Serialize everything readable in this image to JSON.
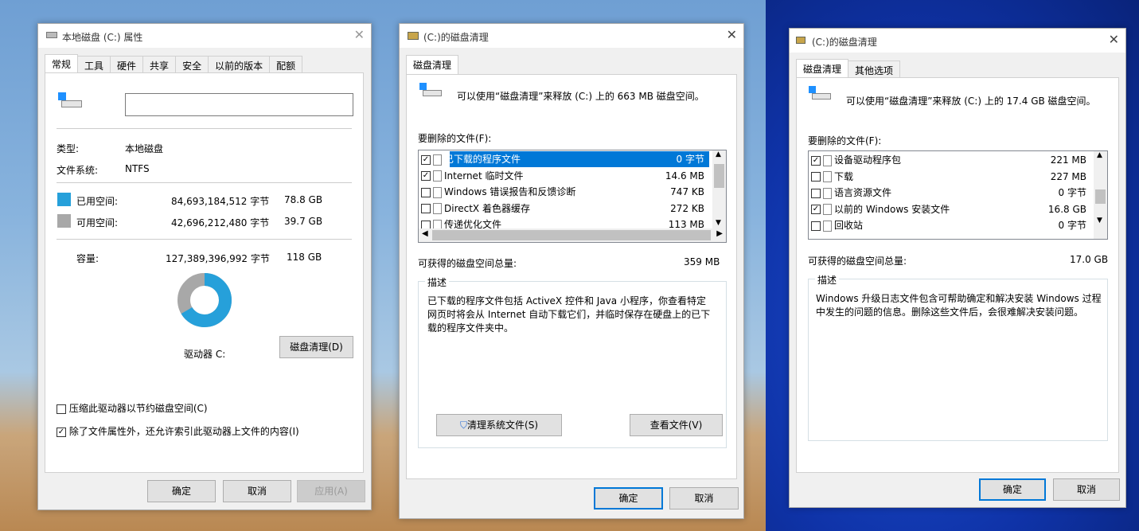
{
  "props": {
    "title": "本地磁盘 (C:) 属性",
    "tabs": [
      "常规",
      "工具",
      "硬件",
      "共享",
      "安全",
      "以前的版本",
      "配额"
    ],
    "type_label": "类型:",
    "type_value": "本地磁盘",
    "fs_label": "文件系统:",
    "fs_value": "NTFS",
    "used_label": "已用空间:",
    "used_bytes": "84,693,184,512 字节",
    "used_gb": "78.8 GB",
    "free_label": "可用空间:",
    "free_bytes": "42,696,212,480 字节",
    "free_gb": "39.7 GB",
    "cap_label": "容量:",
    "cap_bytes": "127,389,396,992 字节",
    "cap_gb": "118 GB",
    "drive_label": "驱动器 C:",
    "cleanup_btn": "磁盘清理(D)",
    "compress_label": "压缩此驱动器以节约磁盘空间(C)",
    "index_label": "除了文件属性外，还允许索引此驱动器上文件的内容(I)",
    "ok": "确定",
    "cancel": "取消",
    "apply": "应用(A)",
    "used_color": "#26a0da",
    "free_color": "#a8a8a8",
    "used_fraction": 0.665
  },
  "clean1": {
    "title": "(C:)的磁盘清理",
    "tab": "磁盘清理",
    "intro": "可以使用“磁盘清理”来释放 (C:) 上的 663 MB 磁盘空间。",
    "files_label": "要删除的文件(F):",
    "files": [
      {
        "checked": true,
        "name": "已下载的程序文件",
        "size": "0 字节"
      },
      {
        "checked": true,
        "name": "Internet 临时文件",
        "size": "14.6 MB"
      },
      {
        "checked": false,
        "name": "Windows 错误报告和反馈诊断",
        "size": "747 KB"
      },
      {
        "checked": false,
        "name": "DirectX 着色器缓存",
        "size": "272 KB"
      },
      {
        "checked": false,
        "name": "传递优化文件",
        "size": "113 MB"
      }
    ],
    "total_label": "可获得的磁盘空间总量:",
    "total_value": "359 MB",
    "desc_label": "描述",
    "desc": "已下载的程序文件包括 ActiveX 控件和 Java 小程序，你查看特定网页时将会从 Internet 自动下载它们，并临时保存在硬盘上的已下载的程序文件夹中。",
    "sys_btn": "清理系统文件(S)",
    "view_btn": "查看文件(V)",
    "ok": "确定",
    "cancel": "取消"
  },
  "clean2": {
    "title": "(C:)的磁盘清理",
    "tabs": [
      "磁盘清理",
      "其他选项"
    ],
    "intro": "可以使用“磁盘清理”来释放 (C:) 上的 17.4 GB 磁盘空间。",
    "files_label": "要删除的文件(F):",
    "files": [
      {
        "checked": true,
        "name": "设备驱动程序包",
        "size": "221 MB"
      },
      {
        "checked": false,
        "name": "下载",
        "size": "227 MB"
      },
      {
        "checked": false,
        "name": "语言资源文件",
        "size": "0 字节"
      },
      {
        "checked": true,
        "name": "以前的 Windows 安装文件",
        "size": "16.8 GB"
      },
      {
        "checked": false,
        "name": "回收站",
        "size": "0 字节"
      }
    ],
    "total_label": "可获得的磁盘空间总量:",
    "total_value": "17.0 GB",
    "desc_label": "描述",
    "desc": "Windows 升级日志文件包含可帮助确定和解决安装 Windows 过程中发生的问题的信息。删除这些文件后，会很难解决安装问题。",
    "ok": "确定",
    "cancel": "取消"
  }
}
